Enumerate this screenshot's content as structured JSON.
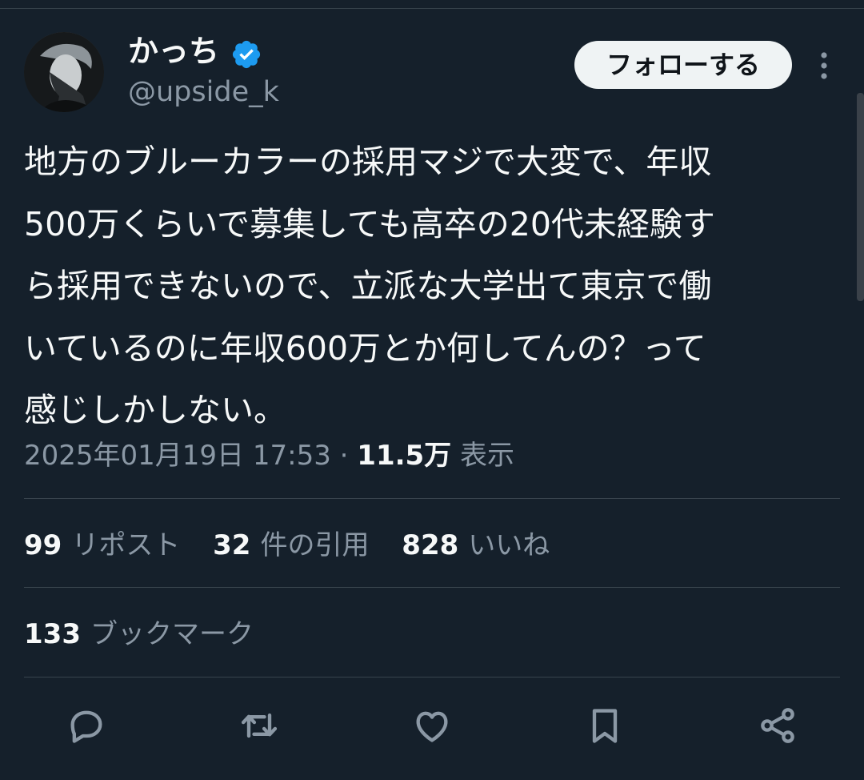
{
  "user": {
    "display_name": "かっち",
    "handle": "@upside_k",
    "verified": true
  },
  "header": {
    "follow_label": "フォローする"
  },
  "tweet": {
    "lines": [
      "地方のブルーカラーの採用マジで大変で、年収",
      "500万くらいで募集しても高卒の20代未経験す",
      "ら採用できないので、立派な大学出て東京で働",
      "いているのに年収600万とか何してんの？って",
      "感じしかしない。"
    ],
    "timestamp": "2025年01月19日 17:53",
    "separator": "·",
    "views_count": "11.5万",
    "views_label": "表示"
  },
  "stats": {
    "reposts_count": "99",
    "reposts_label": "リポスト",
    "quotes_count": "32",
    "quotes_label": "件の引用",
    "likes_count": "828",
    "likes_label": "いいね",
    "bookmarks_count": "133",
    "bookmarks_label": "ブックマーク"
  },
  "actions": [
    {
      "icon": "reply-icon"
    },
    {
      "icon": "retweet-icon"
    },
    {
      "icon": "like-icon"
    },
    {
      "icon": "bookmark-icon"
    },
    {
      "icon": "share-icon"
    }
  ],
  "colors": {
    "background": "#15202b",
    "text_primary": "#f7f9f9",
    "text_secondary": "#8b98a5",
    "verified_blue": "#1d9bf0",
    "divider": "#38444d",
    "follow_button_bg": "#eff3f4"
  }
}
